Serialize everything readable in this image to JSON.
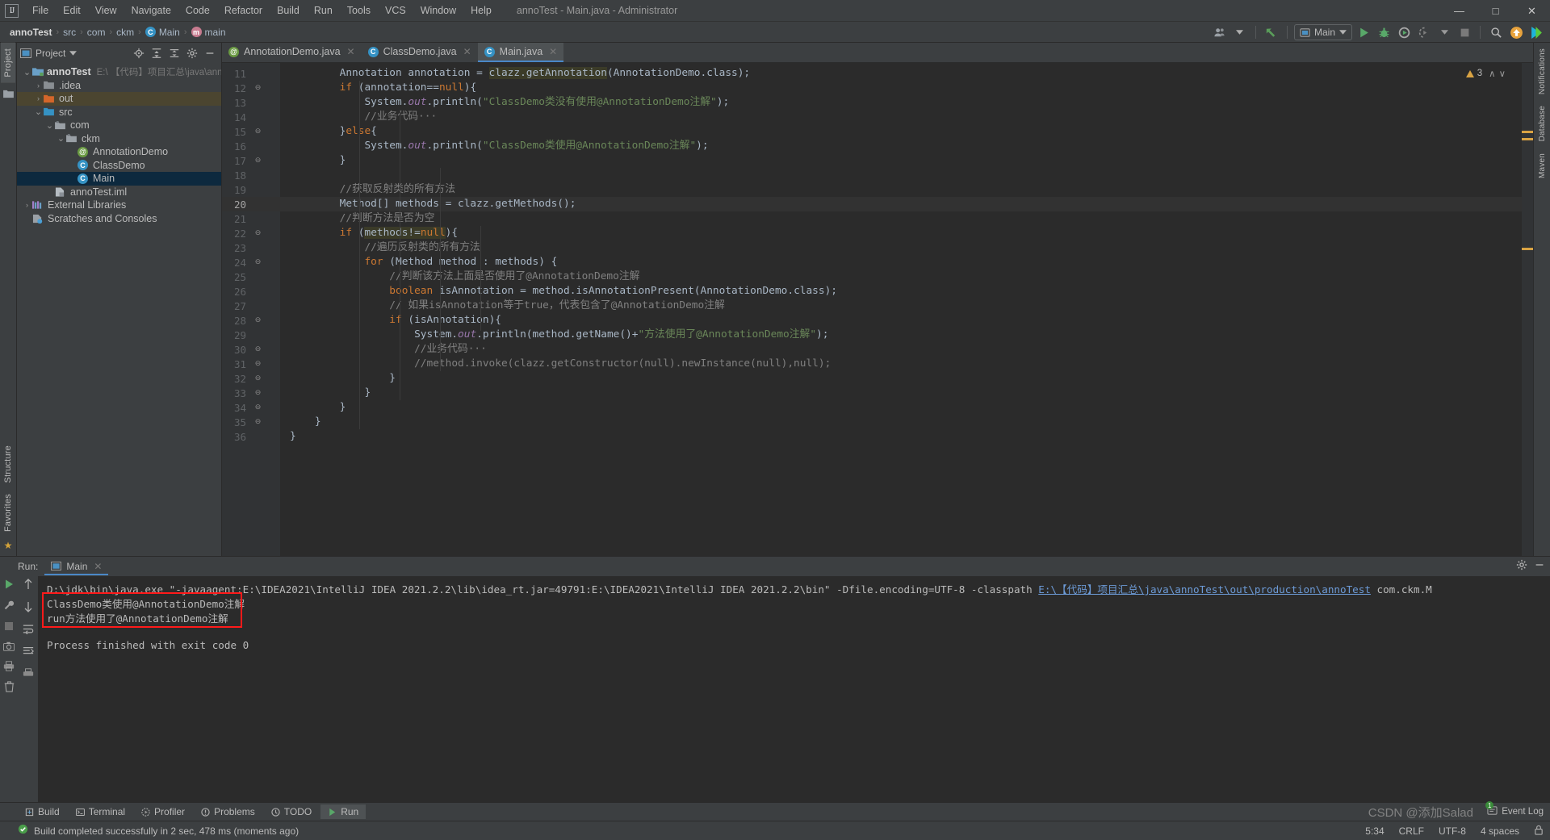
{
  "window": {
    "title": "annoTest - Main.java - Administrator",
    "logo": "IJ",
    "minimize": "—",
    "maximize": "□",
    "close": "✕"
  },
  "menu": [
    "File",
    "Edit",
    "View",
    "Navigate",
    "Code",
    "Refactor",
    "Build",
    "Run",
    "Tools",
    "VCS",
    "Window",
    "Help"
  ],
  "navbar": {
    "crumbs": [
      "annoTest",
      "src",
      "com",
      "ckm",
      "Main",
      "main"
    ],
    "separator": "›",
    "run_config": "Main",
    "icons": [
      "user-avatar-icon",
      "chevron-down-icon",
      "back-arrow-icon",
      "run-icon",
      "debug-icon",
      "run-coverage-icon",
      "profiler-icon",
      "stop-icon",
      "search-icon",
      "updates-icon",
      "ide-icon"
    ]
  },
  "left_strip": {
    "top_tab": "Project",
    "bottom_tabs": [
      "Structure",
      "Favorites"
    ]
  },
  "right_strip": {
    "tabs": [
      "Database",
      "Maven",
      "Notifications"
    ]
  },
  "project_panel": {
    "title": "Project",
    "tree": [
      {
        "label": "annoTest",
        "path": "E:\\ 【代码】项目汇总\\java\\annoTest",
        "indent": 0,
        "arrow": "⌄",
        "icon": "module-folder-icon",
        "color": "#6aa0c8",
        "bold": true,
        "state": "normal"
      },
      {
        "label": ".idea",
        "path": "",
        "indent": 1,
        "arrow": "›",
        "icon": "folder-icon",
        "color": "#8a8f93",
        "bold": false,
        "state": "normal"
      },
      {
        "label": "out",
        "path": "",
        "indent": 1,
        "arrow": "›",
        "icon": "folder-icon",
        "color": "#d4662a",
        "bold": false,
        "state": "highlight"
      },
      {
        "label": "src",
        "path": "",
        "indent": 1,
        "arrow": "⌄",
        "icon": "source-folder-icon",
        "color": "#3592c4",
        "bold": false,
        "state": "normal"
      },
      {
        "label": "com",
        "path": "",
        "indent": 2,
        "arrow": "⌄",
        "icon": "package-icon",
        "color": "#9aa0a6",
        "bold": false,
        "state": "normal"
      },
      {
        "label": "ckm",
        "path": "",
        "indent": 3,
        "arrow": "⌄",
        "icon": "package-icon",
        "color": "#9aa0a6",
        "bold": false,
        "state": "normal"
      },
      {
        "label": "AnnotationDemo",
        "path": "",
        "indent": 4,
        "arrow": "",
        "icon": "annotation-class-icon",
        "color": "#6a9a42",
        "bold": false,
        "state": "normal",
        "glyph": "@"
      },
      {
        "label": "ClassDemo",
        "path": "",
        "indent": 4,
        "arrow": "",
        "icon": "class-icon",
        "color": "#3592c4",
        "bold": false,
        "state": "normal",
        "glyph": "C"
      },
      {
        "label": "Main",
        "path": "",
        "indent": 4,
        "arrow": "",
        "icon": "runnable-class-icon",
        "color": "#3592c4",
        "bold": false,
        "state": "selected",
        "glyph": "C"
      },
      {
        "label": "annoTest.iml",
        "path": "",
        "indent": 2,
        "arrow": "",
        "icon": "iml-file-icon",
        "color": "#9aa0a6",
        "bold": false,
        "state": "normal"
      },
      {
        "label": "External Libraries",
        "path": "",
        "indent": 0,
        "arrow": "›",
        "icon": "libraries-icon",
        "color": "#a07ec8",
        "bold": false,
        "state": "normal"
      },
      {
        "label": "Scratches and Consoles",
        "path": "",
        "indent": 0,
        "arrow": "",
        "icon": "scratches-icon",
        "color": "#9aa0a6",
        "bold": false,
        "state": "normal"
      }
    ]
  },
  "editor": {
    "tabs": [
      {
        "label": "AnnotationDemo.java",
        "icon": "annotation-class-icon",
        "glyph": "@",
        "color": "#6a9a42",
        "active": false
      },
      {
        "label": "ClassDemo.java",
        "icon": "class-icon",
        "glyph": "C",
        "color": "#3592c4",
        "active": false
      },
      {
        "label": "Main.java",
        "icon": "runnable-class-icon",
        "glyph": "C",
        "color": "#3592c4",
        "active": true
      }
    ],
    "close_glyph": "✕",
    "inspection": {
      "count": "3",
      "up": "∧",
      "down": "∨"
    },
    "first_line": 11,
    "current_line": 20,
    "lines": [
      {
        "n": 11,
        "fold": "",
        "html": "        Annotation annotation = <span class=\"hl-box\">clazz.getAnnotation</span>(AnnotationDemo.class);",
        "text": "        Annotation annotation = clazz.getAnnotation(AnnotationDemo.class);"
      },
      {
        "n": 12,
        "fold": "⊖",
        "html": "        <span class=\"kw\">if</span> (annotation==<span class=\"kw\">null</span>){",
        "text": "        if (annotation==null){"
      },
      {
        "n": 13,
        "fold": "",
        "html": "            System.<span class=\"fld\"><i>out</i></span>.println(<span class=\"str\">\"ClassDemo类没有使用@AnnotationDemo注解\"</span>);",
        "text": "            System.out.println(\"ClassDemo类没有使用@AnnotationDemo注解\");"
      },
      {
        "n": 14,
        "fold": "",
        "html": "            <span class=\"cm\">//业务代码···</span>",
        "text": "            //业务代码···"
      },
      {
        "n": 15,
        "fold": "⊖",
        "html": "        }<span class=\"kw\">else</span>{",
        "text": "        }else{"
      },
      {
        "n": 16,
        "fold": "",
        "html": "            System.<span class=\"fld\"><i>out</i></span>.println(<span class=\"str\">\"ClassDemo类使用@AnnotationDemo注解\"</span>);",
        "text": "            System.out.println(\"ClassDemo类使用@AnnotationDemo注解\");"
      },
      {
        "n": 17,
        "fold": "⊖",
        "html": "        }",
        "text": "        }"
      },
      {
        "n": 18,
        "fold": "",
        "html": "",
        "text": ""
      },
      {
        "n": 19,
        "fold": "",
        "html": "        <span class=\"cm\">//获取反射类的所有方法</span>",
        "text": "        //获取反射类的所有方法"
      },
      {
        "n": 20,
        "fold": "",
        "html": "        Method[] methods = clazz.getMethods();",
        "text": "        Method[] methods = clazz.getMethods();"
      },
      {
        "n": 21,
        "fold": "",
        "html": "        <span class=\"cm\">//判断方法是否为空</span>",
        "text": "        //判断方法是否为空"
      },
      {
        "n": 22,
        "fold": "⊖",
        "html": "        <span class=\"kw\">if</span> (<span class=\"hl-box\">methods!=<span class=\"kw\">null</span></span>){",
        "text": "        if (methods!=null){"
      },
      {
        "n": 23,
        "fold": "",
        "html": "            <span class=\"cm\">//遍历反射类的所有方法</span>",
        "text": "            //遍历反射类的所有方法"
      },
      {
        "n": 24,
        "fold": "⊖",
        "html": "            <span class=\"kw\">for</span> (Method method : methods) {",
        "text": "            for (Method method : methods) {"
      },
      {
        "n": 25,
        "fold": "",
        "html": "                <span class=\"cm\">//判断该方法上面是否使用了@AnnotationDemo注解</span>",
        "text": "                //判断该方法上面是否使用了@AnnotationDemo注解"
      },
      {
        "n": 26,
        "fold": "",
        "html": "                <span class=\"kw\">boolean</span> isAnnotation = method.isAnnotationPresent(AnnotationDemo.class);",
        "text": "                boolean isAnnotation = method.isAnnotationPresent(AnnotationDemo.class);"
      },
      {
        "n": 27,
        "fold": "",
        "html": "                <span class=\"cm\">// 如果isAnnotation等于true，代表包含了@AnnotationDemo注解</span>",
        "text": "                // 如果isAnnotation等于true，代表包含了@AnnotationDemo注解"
      },
      {
        "n": 28,
        "fold": "⊖",
        "html": "                <span class=\"kw\">if</span> (isAnnotation){",
        "text": "                if (isAnnotation){"
      },
      {
        "n": 29,
        "fold": "",
        "html": "                    System.<span class=\"fld\"><i>out</i></span>.println(method.getName()+<span class=\"str\">\"方法使用了@AnnotationDemo注解\"</span>);",
        "text": "                    System.out.println(method.getName()+\"方法使用了@AnnotationDemo注解\");"
      },
      {
        "n": 30,
        "fold": "⊖",
        "html": "                    <span class=\"cm\">//业务代码···</span>",
        "text": "                    //业务代码···"
      },
      {
        "n": 31,
        "fold": "⊖",
        "html": "                    <span class=\"cm\">//method.invoke(clazz.getConstructor(null).newInstance(null),null);</span>",
        "text": "                    //method.invoke(clazz.getConstructor(null).newInstance(null),null);"
      },
      {
        "n": 32,
        "fold": "⊖",
        "html": "                }",
        "text": "                }"
      },
      {
        "n": 33,
        "fold": "⊖",
        "html": "            }",
        "text": "            }"
      },
      {
        "n": 34,
        "fold": "⊖",
        "html": "        }",
        "text": "        }"
      },
      {
        "n": 35,
        "fold": "⊖",
        "html": "    }",
        "text": "    }"
      },
      {
        "n": 36,
        "fold": "",
        "html": "}",
        "text": "}"
      }
    ]
  },
  "run_panel": {
    "label": "Run:",
    "tab": "Main",
    "tab_close": "✕",
    "settings_icon": "gear-icon",
    "minimize_icon": "minimize-icon",
    "side_icons": [
      "rerun-icon",
      "wrench-icon",
      "stop-icon",
      "camera-icon",
      "print-icon",
      "clear-icon",
      "trash-icon"
    ],
    "side_icons2": [
      "scroll-up-icon",
      "scroll-down-icon",
      "soft-wrap-icon",
      "scroll-end-icon",
      "print-icon"
    ],
    "console": {
      "command_prefix": "D:\\jdk\\bin\\java.exe \"-javaagent:E:\\IDEA2021\\IntelliJ IDEA 2021.2.2\\lib\\idea_rt.jar=49791:E:\\IDEA2021\\IntelliJ IDEA 2021.2.2\\bin\" -Dfile.encoding=UTF-8 -classpath ",
      "classpath_link": "E:\\【代码】项目汇总\\java\\annoTest\\out\\production\\annoTest",
      "command_suffix": " com.ckm.M",
      "output": [
        "ClassDemo类使用@AnnotationDemo注解",
        "run方法使用了@AnnotationDemo注解"
      ],
      "exit_line": "Process finished with exit code 0",
      "highlight_color": "#ff1a1a"
    }
  },
  "bottom_toolbar": {
    "items": [
      {
        "label": "Run",
        "icon": "run-icon",
        "active": true
      },
      {
        "label": "TODO",
        "icon": "todo-icon",
        "active": false
      },
      {
        "label": "Problems",
        "icon": "problems-icon",
        "active": false
      },
      {
        "label": "Profiler",
        "icon": "profiler-icon",
        "active": false
      },
      {
        "label": "Terminal",
        "icon": "terminal-icon",
        "active": false
      },
      {
        "label": "Build",
        "icon": "build-icon",
        "active": false
      }
    ],
    "event_log": "Event Log",
    "event_log_badge": "1"
  },
  "status_bar": {
    "message": "Build completed successfully in 2 sec, 478 ms (moments ago)",
    "caret": "5:34",
    "line_sep": "CRLF",
    "encoding": "UTF-8",
    "indent": "4 spaces",
    "lock_icon": "lock-icon"
  },
  "watermark": "CSDN @添加Salad"
}
